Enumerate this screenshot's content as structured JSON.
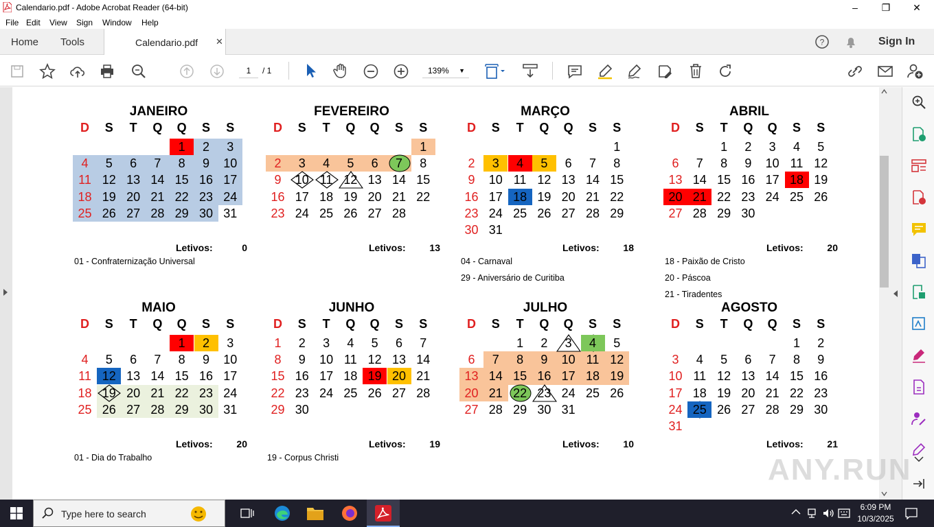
{
  "window": {
    "title": "Calendario.pdf - Adobe Acrobat Reader (64-bit)"
  },
  "menu": [
    "File",
    "Edit",
    "View",
    "Sign",
    "Window",
    "Help"
  ],
  "tabs": {
    "home": "Home",
    "tools": "Tools",
    "doc": "Calendario.pdf",
    "sign_in": "Sign In"
  },
  "toolbar": {
    "page_current": "1",
    "page_total": "/ 1",
    "zoom": "139%"
  },
  "weekday_headers": [
    "D",
    "S",
    "T",
    "Q",
    "Q",
    "S",
    "S"
  ],
  "letivos_label": "Letivos:",
  "colors": {
    "holiday": "#ff0000",
    "sunday": "#e02020",
    "vacation": "#b8cce4",
    "recess": "#f9c49a",
    "event": "#ffc000",
    "blue": "#1565c0",
    "green": "#7dc75a",
    "planning": "#ebf1de"
  },
  "months": [
    {
      "name": "JANEIRO",
      "start": 4,
      "days": 31,
      "letivos": "0",
      "notes": [
        "01 - Confraternização Universal"
      ],
      "marks": {
        "1": "holiday"
      },
      "bands": [
        {
          "from": 4,
          "to": 6,
          "week": 0,
          "c": "vacation"
        },
        {
          "from": 0,
          "to": 6,
          "week": 1,
          "c": "vacation"
        },
        {
          "from": 0,
          "to": 6,
          "week": 2,
          "c": "vacation"
        },
        {
          "from": 0,
          "to": 6,
          "week": 3,
          "c": "vacation"
        },
        {
          "from": 0,
          "to": 5,
          "week": 4,
          "c": "vacation"
        }
      ],
      "shapes": {}
    },
    {
      "name": "FEVEREIRO",
      "start": 6,
      "days": 28,
      "letivos": "13",
      "notes": [],
      "marks": {},
      "bands": [
        {
          "from": 6,
          "to": 6,
          "week": 0,
          "c": "recess"
        },
        {
          "from": 0,
          "to": 5,
          "week": 1,
          "c": "recess"
        }
      ],
      "shapes": {
        "7": "circle-green",
        "10": "diamond",
        "11": "diamond",
        "12": "triangle"
      }
    },
    {
      "name": "MARÇO",
      "start": 6,
      "days": 31,
      "letivos": "18",
      "notes": [
        "04 - Carnaval",
        "29 - Aniversário de Curitiba"
      ],
      "marks": {
        "3": "event",
        "4": "holiday",
        "5": "event",
        "18": "blue"
      },
      "bands": [],
      "shapes": {}
    },
    {
      "name": "ABRIL",
      "start": 2,
      "days": 30,
      "letivos": "20",
      "notes": [
        "18 - Paixão de Cristo",
        "20 - Páscoa",
        "21 - Tiradentes"
      ],
      "marks": {
        "18": "holiday",
        "20": "holiday",
        "21": "holiday"
      },
      "bands": [],
      "shapes": {}
    },
    {
      "name": "MAIO",
      "start": 4,
      "days": 31,
      "letivos": "20",
      "notes": [
        "01 - Dia do Trabalho"
      ],
      "marks": {
        "1": "holiday",
        "2": "event",
        "12": "blue"
      },
      "bands": [
        {
          "from": 1,
          "to": 5,
          "week": 3,
          "c": "planning"
        },
        {
          "from": 1,
          "to": 5,
          "week": 4,
          "c": "planning"
        }
      ],
      "shapes": {
        "19": "diamond"
      }
    },
    {
      "name": "JUNHO",
      "start": 0,
      "days": 30,
      "letivos": "19",
      "notes": [
        "19 - Corpus Christi"
      ],
      "marks": {
        "19": "holiday",
        "20": "event"
      },
      "bands": [],
      "shapes": {}
    },
    {
      "name": "JULHO",
      "start": 2,
      "days": 31,
      "letivos": "10",
      "notes": [],
      "marks": {
        "4": "green"
      },
      "bands": [
        {
          "from": 1,
          "to": 6,
          "week": 1,
          "c": "recess"
        },
        {
          "from": 0,
          "to": 6,
          "week": 2,
          "c": "recess"
        },
        {
          "from": 0,
          "to": 1,
          "week": 3,
          "c": "recess"
        }
      ],
      "shapes": {
        "3": "triangle",
        "4": "diamond",
        "22": "circle-green",
        "23": "triangle"
      }
    },
    {
      "name": "AGOSTO",
      "start": 5,
      "days": 31,
      "letivos": "21",
      "notes": [],
      "marks": {
        "25": "blue"
      },
      "bands": [],
      "shapes": {
        "25": "diamond"
      }
    }
  ],
  "taskbar": {
    "search_placeholder": "Type here to search",
    "time": "6:09 PM",
    "date": "10/3/2025"
  },
  "watermark": "ANY.RUN"
}
